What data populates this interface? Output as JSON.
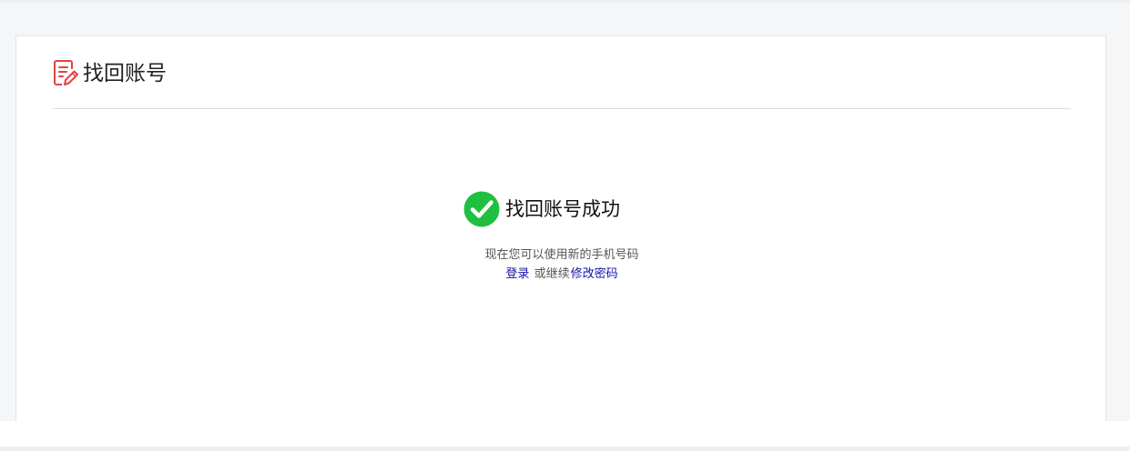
{
  "header": {
    "title": "找回账号",
    "icon": "edit-document-icon",
    "icon_color": "#e0443f"
  },
  "result": {
    "icon": "check-circle-icon",
    "icon_color": "#1fbf3f",
    "title": "找回账号成功",
    "description": "现在您可以使用新的手机号码",
    "login_link": "登录",
    "middle_text": "或继续",
    "change_password_link": "修改密码",
    "link_color": "#1010a8"
  }
}
